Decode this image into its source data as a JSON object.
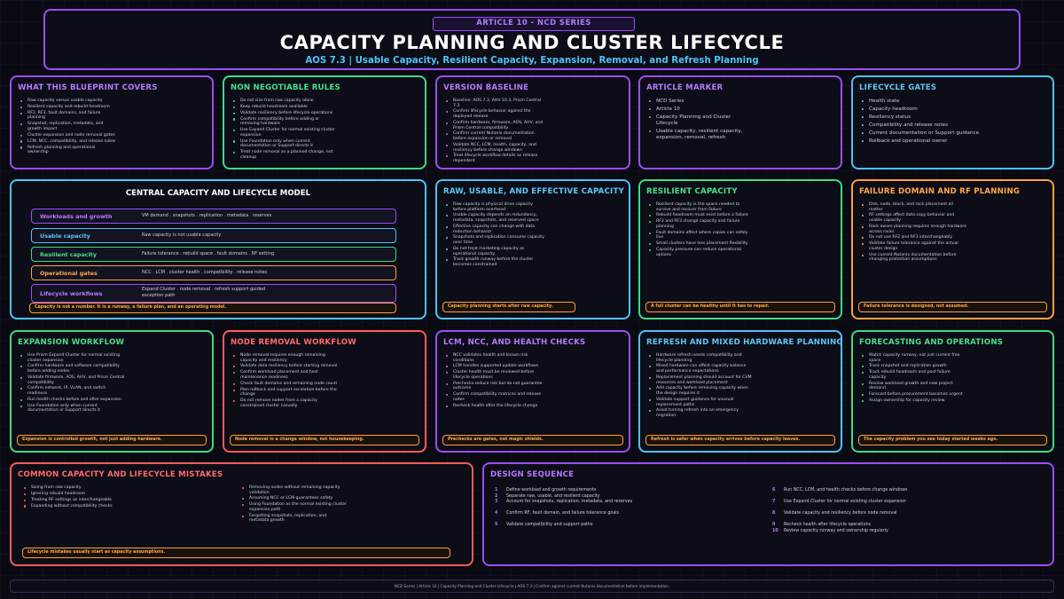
{
  "header": {
    "tag": "ARTICLE 10 - NCD SERIES",
    "title": "CAPACITY PLANNING AND CLUSTER LIFECYCLE",
    "subtitle": "AOS 7.3 | Usable Capacity, Resilient Capacity, Expansion, Removal, and Refresh Planning"
  },
  "blueprint": {
    "title": "WHAT THIS BLUEPRINT COVERS",
    "items": [
      "Raw capacity versus usable capacity",
      "Resilient capacity and rebuild headroom",
      "RF2, RF3, fault domains, and failure planning",
      "Snapshot, replication, metadata, and growth impact",
      "Cluster expansion and node removal gates",
      "LCM, NCC, compatibility, and release notes",
      "Refresh planning and operational ownership"
    ]
  },
  "rules": {
    "title": "NON NEGOTIABLE RULES",
    "items": [
      "Do not size from raw capacity alone",
      "Keep rebuild headroom available",
      "Validate resiliency before lifecycle operations",
      "Confirm compatibility before adding or removing hardware",
      "Use Expand Cluster for normal existing cluster expansion",
      "Use Foundation only when current documentation or Support directs it",
      "Treat node removal as a planned change, not cleanup"
    ]
  },
  "version": {
    "title": "VERSION BASELINE",
    "items": [
      "Baseline: AOS 7.3, AHV 10.3, Prism Central 7.3",
      "Confirm lifecycle behavior against the deployed release",
      "Confirm hardware, firmware, AOS, AHV, and Prism Central compatibility",
      "Confirm current Nutanix documentation before expansion or removal",
      "Validate NCC, LCM, health, capacity, and resiliency before change windows",
      "Treat lifecycle workflow details as release dependent"
    ]
  },
  "marker": {
    "title": "ARTICLE MARKER",
    "items": [
      "NCD Series",
      "Article 10",
      "Capacity Planning and Cluster Lifecycle",
      "Usable capacity, resilient capacity, expansion, removal, refresh"
    ]
  },
  "gates": {
    "title": "LIFECYCLE GATES",
    "items": [
      "Health state",
      "Capacity headroom",
      "Resiliency status",
      "Compatibility and release notes",
      "Current documentation or Support guidance",
      "Rollback and operational owner"
    ]
  },
  "model": {
    "title": "CENTRAL CAPACITY AND LIFECYCLE MODEL",
    "rows": [
      {
        "label": "Workloads and growth",
        "desc": "VM demand . snapshots . replication . metadata . reserves"
      },
      {
        "label": "Usable capacity",
        "desc": "Raw capacity is not usable capacity"
      },
      {
        "label": "Resilient capacity",
        "desc": "Failure tolerance . rebuild space . fault domains . RF setting"
      },
      {
        "label": "Operational gates",
        "desc": "NCC . LCM . cluster health . compatibility . release notes"
      },
      {
        "label": "Lifecycle workflows",
        "desc": "Expand Cluster . node removal . refresh support guided exception path"
      }
    ],
    "hidden_text": "Ownership loop",
    "callout": "Capacity is not a number. It is a runway, a failure plan, and an operating model."
  },
  "raw": {
    "title": "RAW, USABLE, AND EFFECTIVE CAPACITY",
    "items": [
      "Raw capacity is physical drive capacity before platform overhead",
      "Usable capacity depends on redundancy, metadata, snapshots, and reserved space",
      "Effective capacity can change with data reduction behavior",
      "Snapshots and replication consume capacity over time",
      "Do not treat marketing capacity as operational capacity",
      "Track growth runway before the cluster becomes constrained"
    ],
    "callout": "Capacity planning starts after raw capacity."
  },
  "resilient": {
    "title": "RESILIENT CAPACITY",
    "items": [
      "Resilient capacity is the space needed to survive and recover from failure",
      "Rebuild headroom must exist before a failure",
      "RF2 and RF3 change capacity and failure planning",
      "Fault domains affect where copies can safely live",
      "Small clusters have less placement flexibility",
      "Capacity pressure can reduce operational options"
    ],
    "callout": "A full cluster can be healthy until it has to repair."
  },
  "failure": {
    "title": "FAILURE DOMAIN AND RF PLANNING",
    "items": [
      "Disk, node, block, and rack placement all matter",
      "RF settings affect data copy behavior and usable capacity",
      "Rack aware planning requires enough hardware across racks",
      "Do not use RF2 and RF3 interchangeably",
      "Validate failure tolerance against the actual cluster design",
      "Use current Nutanix documentation before changing protection assumptions"
    ],
    "callout": "Failure tolerance is designed, not assumed."
  },
  "expansion": {
    "title": "EXPANSION WORKFLOW",
    "items": [
      "Use Prism Expand Cluster for normal existing cluster expansion",
      "Confirm hardware and software compatibility before adding nodes",
      "Validate firmware, AOS, AHV, and Prism Central compatibility",
      "Confirm network, IP, VLAN, and switch readiness",
      "Run health checks before and after expansion",
      "Use Foundation only when current documentation or Support directs it"
    ],
    "callout": "Expansion is controlled growth, not just adding hardware."
  },
  "removal": {
    "title": "NODE REMOVAL WORKFLOW",
    "items": [
      "Node removal requires enough remaining capacity and resiliency",
      "Validate data resiliency before starting removal",
      "Confirm workload placement and host maintenance readiness",
      "Check fault domains and remaining node count",
      "Plan rollback and support escalation before the change",
      "Do not remove nodes from a capacity constrained cluster casually"
    ],
    "callout": "Node removal is a change window, not housekeeping."
  },
  "lcm": {
    "title": "LCM, NCC, AND HEALTH CHECKS",
    "items": [
      "NCC validates health and known risk conditions",
      "LCM handles supported update workflows",
      "Cluster health must be reviewed before lifecycle operations",
      "Prechecks reduce risk but do not guarantee outcome",
      "Confirm compatibility matrices and release notes",
      "Recheck health after the lifecycle change"
    ],
    "callout": "Prechecks are gates, not magic shields."
  },
  "refresh": {
    "title": "REFRESH AND MIXED HARDWARE PLANNING",
    "items": [
      "Hardware refresh needs compatibility and lifecycle planning",
      "Mixed hardware can affect capacity balance and performance expectations",
      "Replacement planning should account for CVM resources and workload placement",
      "Add capacity before removing capacity when the design requires it",
      "Validate support guidance for unusual replacement paths",
      "Avoid turning refresh into an emergency migration"
    ],
    "callout": "Refresh is safer when capacity arrives before capacity leaves."
  },
  "forecast": {
    "title": "FORECASTING AND OPERATIONS",
    "items": [
      "Watch capacity runway, not just current free space",
      "Track snapshot and replication growth",
      "Track rebuild headroom and post failure capacity",
      "Review workload growth and new project demand",
      "Forecast before procurement becomes urgent",
      "Assign ownership for capacity review"
    ],
    "callout": "The capacity problem you see today started weeks ago."
  },
  "mistakes": {
    "title": "COMMON CAPACITY AND LIFECYCLE MISTAKES",
    "left": [
      "Sizing from raw capacity",
      "Ignoring rebuild headroom",
      "Treating RF settings as interchangeable",
      "Expanding without compatibility checks"
    ],
    "right": [
      "Removing nodes without remaining capacity validation",
      "Assuming NCC or LCM guarantees safety",
      "Using Foundation as the normal existing cluster expansion path",
      "Forgetting snapshots, replication, and metadata growth"
    ],
    "callout": "Lifecycle mistakes usually start as capacity assumptions."
  },
  "sequence": {
    "title": "DESIGN SEQUENCE",
    "steps": [
      {
        "n": "1",
        "text": "Define workload and growth requirements"
      },
      {
        "n": "2",
        "text": "Separate raw, usable, and resilient capacity"
      },
      {
        "n": "3",
        "text": "Account for snapshots, replication, metadata, and reserves"
      },
      {
        "n": "4",
        "text": "Confirm RF, fault domain, and failure tolerance goals"
      },
      {
        "n": "5",
        "text": "Validate compatibility and support paths"
      },
      {
        "n": "6",
        "text": "Run NCC, LCM, and health checks before change windows"
      },
      {
        "n": "7",
        "text": "Use Expand Cluster for normal existing cluster expansion"
      },
      {
        "n": "8",
        "text": "Validate capacity and resiliency before node removal"
      },
      {
        "n": "9",
        "text": "Recheck health after lifecycle operations"
      },
      {
        "n": "10",
        "text": "Review capacity runway and ownership regularly"
      }
    ]
  },
  "footer": {
    "text": "NCD Series | Article 10 | Capacity Planning and Cluster Lifecycle | AOS 7.3 | Confirm against current Nutanix documentation before implementation."
  }
}
